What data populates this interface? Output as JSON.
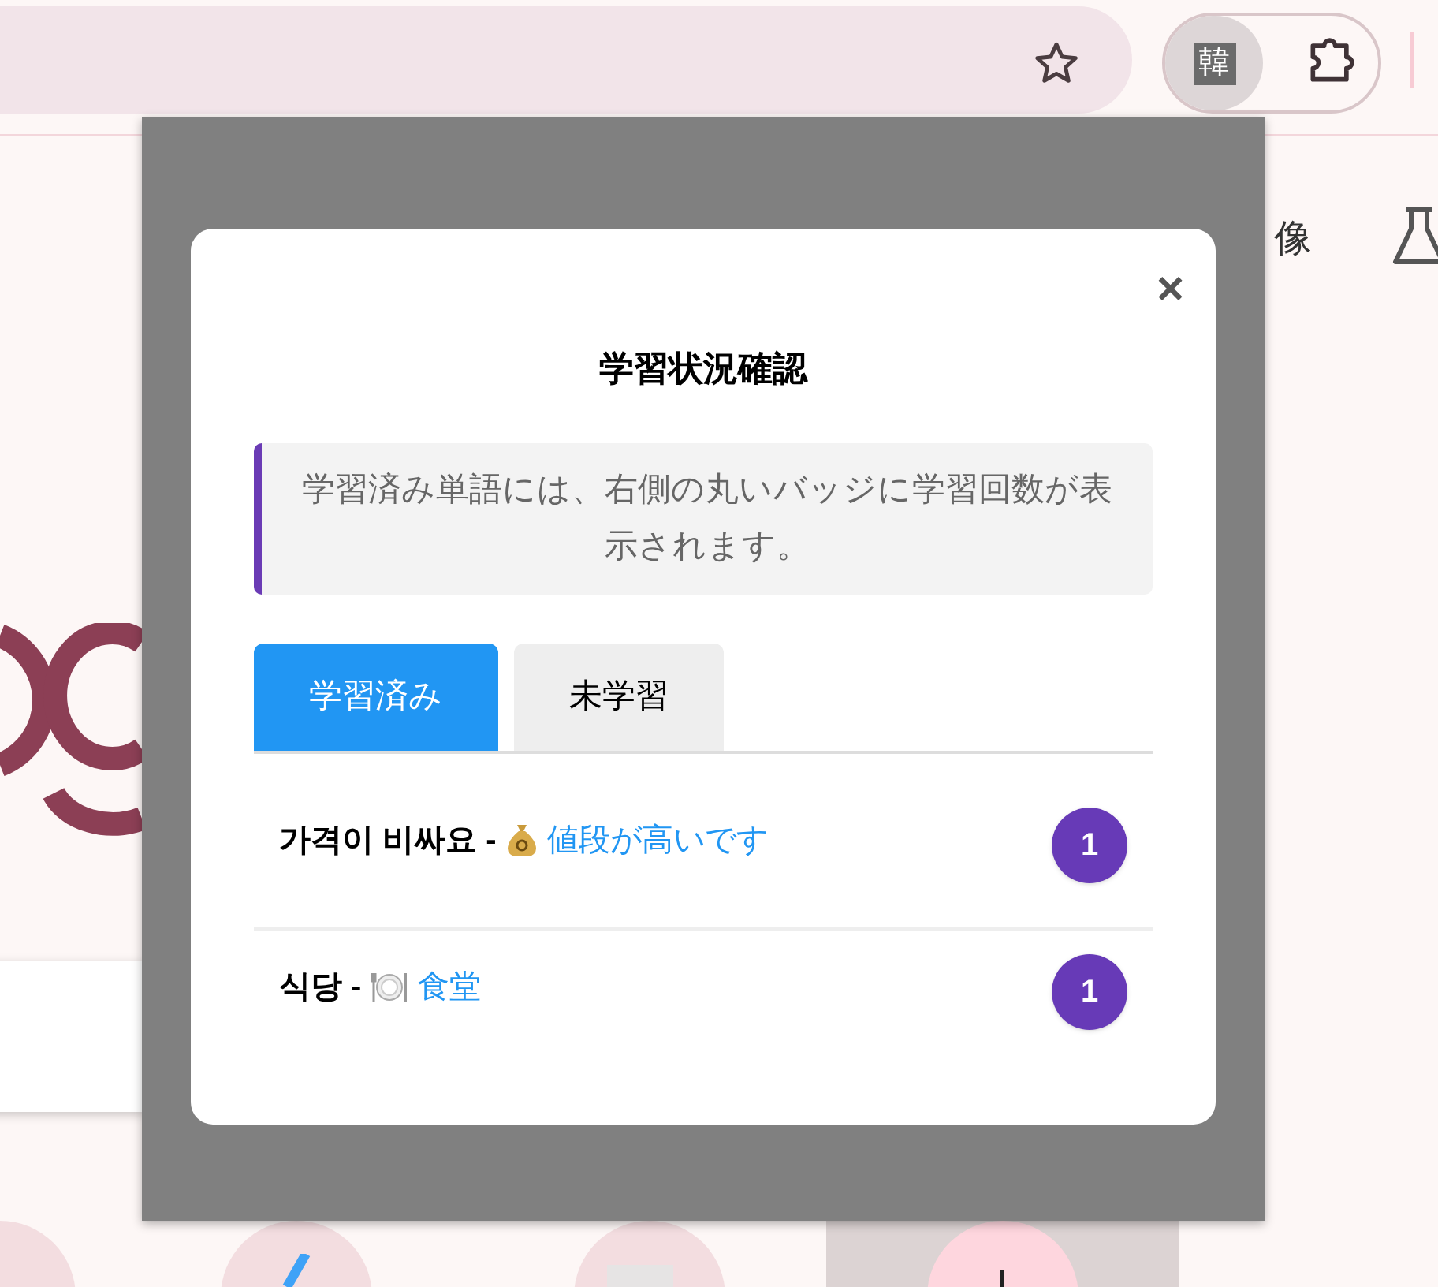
{
  "toolbar": {
    "extension_label": "韓"
  },
  "page": {
    "nav_text": "像"
  },
  "dialog": {
    "title": "学習状況確認",
    "close": "×",
    "info": "学習済み単語には、右側の丸いバッジに学習回数が表示されます。",
    "tabs": [
      {
        "label": "学習済み",
        "selected": true
      },
      {
        "label": "未学習",
        "selected": false
      }
    ],
    "words": [
      {
        "korean": "가격이 비싸요 -",
        "kind": "money",
        "japanese": "値段が高いです",
        "count": "1"
      },
      {
        "korean": "식당 -",
        "kind": "food",
        "japanese": "食堂",
        "count": "1"
      }
    ]
  }
}
